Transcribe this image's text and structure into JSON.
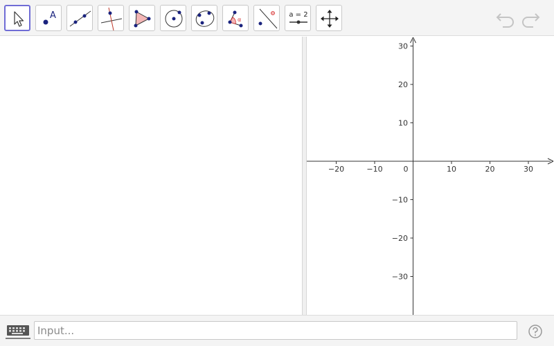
{
  "toolbar": {
    "tools": [
      {
        "icon": "move-arrow-icon",
        "active": true
      },
      {
        "icon": "point-icon",
        "point_label": "A"
      },
      {
        "icon": "line-icon"
      },
      {
        "icon": "perpendicular-line-icon"
      },
      {
        "icon": "polygon-icon"
      },
      {
        "icon": "circle-center-point-icon"
      },
      {
        "icon": "conic-through-points-icon"
      },
      {
        "icon": "angle-icon",
        "angle_label": "α"
      },
      {
        "icon": "reflect-icon"
      },
      {
        "icon": "slider-icon",
        "slider_label": "a = 2"
      },
      {
        "icon": "move-graphics-view-icon"
      }
    ],
    "undo_icon": "undo-icon",
    "redo_icon": "redo-icon"
  },
  "graphics": {
    "x_ticks": [
      "−20",
      "−10",
      "0",
      "10",
      "20",
      "30"
    ],
    "y_ticks": [
      "30",
      "20",
      "10",
      "−10",
      "−20",
      "−30"
    ]
  },
  "input_bar": {
    "placeholder": "Input...",
    "value": "",
    "keyboard_icon": "keyboard-icon",
    "help_icon": "help-icon"
  },
  "colors": {
    "active_border": "#6f6cd5",
    "point": "#1a237e",
    "polygon_fill": "#f4b6b6",
    "accent_red": "#d32f2f"
  }
}
